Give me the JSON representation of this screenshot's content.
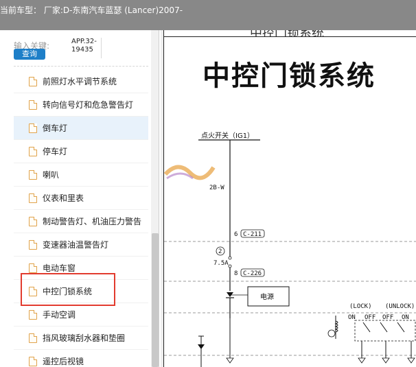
{
  "header": {
    "title": "当前车型：   厂家:D-东南汽车蓝瑟 (Lancer)2007-"
  },
  "search": {
    "label": "输入关键:",
    "button_label": "查询",
    "app_code": "APP.32-19435"
  },
  "topics": [
    {
      "label": "前照灯水平调节系统",
      "icon": "document-icon",
      "selected": false
    },
    {
      "label": "转向信号灯和危急警告灯",
      "icon": "document-icon",
      "selected": false
    },
    {
      "label": "倒车灯",
      "icon": "document-icon",
      "selected": true
    },
    {
      "label": "停车灯",
      "icon": "document-icon",
      "selected": false
    },
    {
      "label": "喇叭",
      "icon": "document-icon",
      "selected": false
    },
    {
      "label": "仪表和里表",
      "icon": "document-icon",
      "selected": false
    },
    {
      "label": "制动警告灯、机油压力警告",
      "icon": "document-icon",
      "selected": false
    },
    {
      "label": "变速器油温警告灯",
      "icon": "document-icon",
      "selected": false
    },
    {
      "label": "电动车窗",
      "icon": "document-icon",
      "selected": false
    },
    {
      "label": "中控门锁系统",
      "icon": "document-icon",
      "selected": false,
      "highlighted": true
    },
    {
      "label": "手动空调",
      "icon": "document-icon",
      "selected": false
    },
    {
      "label": "挡风玻璃刮水器和垫圈",
      "icon": "document-icon",
      "selected": false
    },
    {
      "label": "遥控后视镜",
      "icon": "document-icon",
      "selected": false
    }
  ],
  "document": {
    "header_partial": "中控门锁系统",
    "title": "中控门锁系统",
    "ignition_label": "点火开关（IG1）",
    "wire_label": "2B-W",
    "connector_1_pin": "6",
    "connector_1": "C-211",
    "fuse_number": "2",
    "fuse_rating": "7.5A",
    "connector_2_pin": "8",
    "connector_2": "C-226",
    "power_label": "电源",
    "lock_label": "(LOCK)",
    "unlock_label": "(UNLOCK)",
    "on_1": "ON",
    "off_1": "OFF",
    "off_2": "OFF",
    "on_2": "ON"
  },
  "colors": {
    "header_bg": "#888888",
    "query_button": "#1e7fc8",
    "selected_row": "#e8f2fb",
    "highlight_box": "#e23b2e",
    "doc_icon": "#e0a24a"
  }
}
